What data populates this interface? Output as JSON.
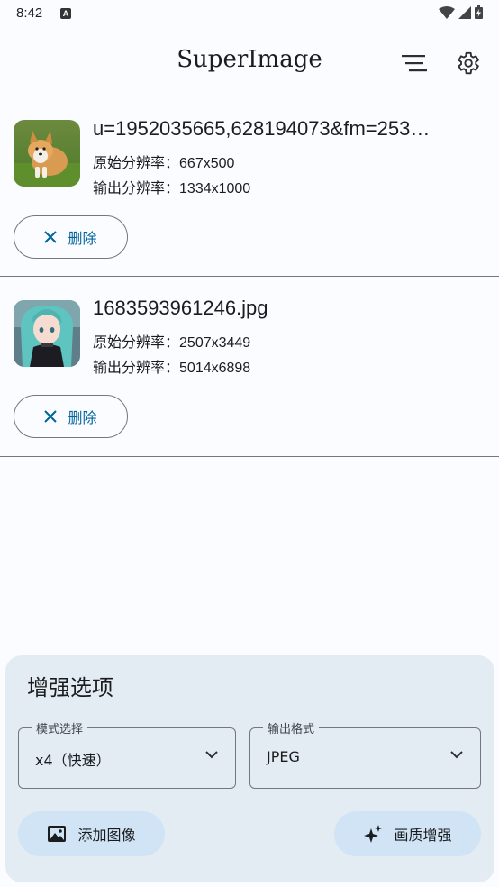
{
  "status_bar": {
    "time": "8:42",
    "notification_letter": "A"
  },
  "app_bar": {
    "title": "SuperImage",
    "list_icon": "sort-lines-icon",
    "settings_icon": "gear-icon"
  },
  "items": [
    {
      "name": "u=1952035665,628194073&fm=253…",
      "original_label": "原始分辨率：",
      "original_value": "667x500",
      "output_label": "输出分辨率：",
      "output_value": "1334x1000",
      "delete_label": "删除",
      "thumb": "corgi-puppy-photo"
    },
    {
      "name": "1683593961246.jpg",
      "original_label": "原始分辨率：",
      "original_value": "2507x3449",
      "output_label": "输出分辨率：",
      "output_value": "5014x6898",
      "delete_label": "删除",
      "thumb": "anime-girl-photo"
    }
  ],
  "options": {
    "title": "增强选项",
    "mode": {
      "legend": "模式选择",
      "value": "x4（快速）"
    },
    "format": {
      "legend": "输出格式",
      "value": "JPEG"
    },
    "add_image_label": "添加图像",
    "enhance_label": "画质增强"
  },
  "colors": {
    "accent": "#00639a",
    "panel": "#e3ebf3",
    "button": "#d0e4f5"
  }
}
